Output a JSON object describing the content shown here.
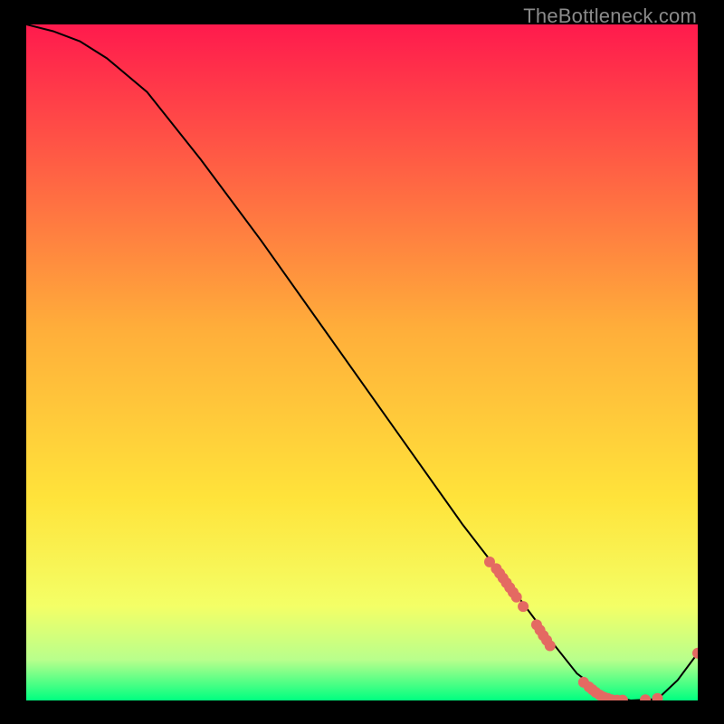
{
  "watermark": "TheBottleneck.com",
  "chart_data": {
    "type": "line",
    "title": "",
    "xlabel": "",
    "ylabel": "",
    "xlim": [
      0,
      100
    ],
    "ylim": [
      0,
      100
    ],
    "grid": false,
    "background": {
      "type": "vertical-gradient",
      "stops": [
        {
          "pos": 0.0,
          "color": "#ff1a4d"
        },
        {
          "pos": 0.45,
          "color": "#ffae3a"
        },
        {
          "pos": 0.7,
          "color": "#ffe33a"
        },
        {
          "pos": 0.86,
          "color": "#f4ff66"
        },
        {
          "pos": 0.94,
          "color": "#b8ff8c"
        },
        {
          "pos": 1.0,
          "color": "#00ff80"
        }
      ]
    },
    "series": [
      {
        "name": "bottleneck-curve",
        "color": "#000000",
        "x": [
          0,
          4,
          8,
          12,
          18,
          26,
          35,
          45,
          55,
          65,
          72,
          78,
          82,
          86,
          90,
          94,
          97,
          100
        ],
        "y": [
          100,
          99,
          97.5,
          95,
          90,
          80,
          68,
          54,
          40,
          26,
          17,
          9,
          4,
          1,
          0,
          0.2,
          3,
          7
        ]
      }
    ],
    "markers": [
      {
        "name": "cluster-a",
        "color": "#e46a62",
        "shape": "circle",
        "points": [
          {
            "x": 69,
            "y": 20.5
          },
          {
            "x": 70,
            "y": 19.5
          },
          {
            "x": 70.5,
            "y": 18.8
          },
          {
            "x": 71,
            "y": 18.1
          },
          {
            "x": 71.5,
            "y": 17.4
          },
          {
            "x": 72,
            "y": 16.7
          },
          {
            "x": 72.5,
            "y": 16.0
          },
          {
            "x": 73,
            "y": 15.3
          },
          {
            "x": 74,
            "y": 13.9
          }
        ]
      },
      {
        "name": "cluster-b",
        "color": "#e46a62",
        "shape": "circle",
        "points": [
          {
            "x": 76,
            "y": 11.2
          },
          {
            "x": 76.5,
            "y": 10.4
          },
          {
            "x": 77,
            "y": 9.6
          },
          {
            "x": 77.5,
            "y": 8.9
          },
          {
            "x": 78,
            "y": 8.1
          }
        ]
      },
      {
        "name": "cluster-c",
        "color": "#e46a62",
        "shape": "circle",
        "points": [
          {
            "x": 83,
            "y": 2.7
          },
          {
            "x": 83.8,
            "y": 2.0
          },
          {
            "x": 84.3,
            "y": 1.6
          },
          {
            "x": 84.8,
            "y": 1.2
          },
          {
            "x": 85.4,
            "y": 0.8
          },
          {
            "x": 86,
            "y": 0.5
          },
          {
            "x": 86.6,
            "y": 0.3
          },
          {
            "x": 87.2,
            "y": 0.1
          },
          {
            "x": 88,
            "y": 0.05
          },
          {
            "x": 88.8,
            "y": 0.05
          }
        ]
      },
      {
        "name": "cluster-d",
        "color": "#e46a62",
        "shape": "circle",
        "points": [
          {
            "x": 92.2,
            "y": 0.1
          },
          {
            "x": 94,
            "y": 0.3
          }
        ]
      },
      {
        "name": "end-point",
        "color": "#e46a62",
        "shape": "circle",
        "points": [
          {
            "x": 100,
            "y": 7
          }
        ]
      }
    ]
  }
}
